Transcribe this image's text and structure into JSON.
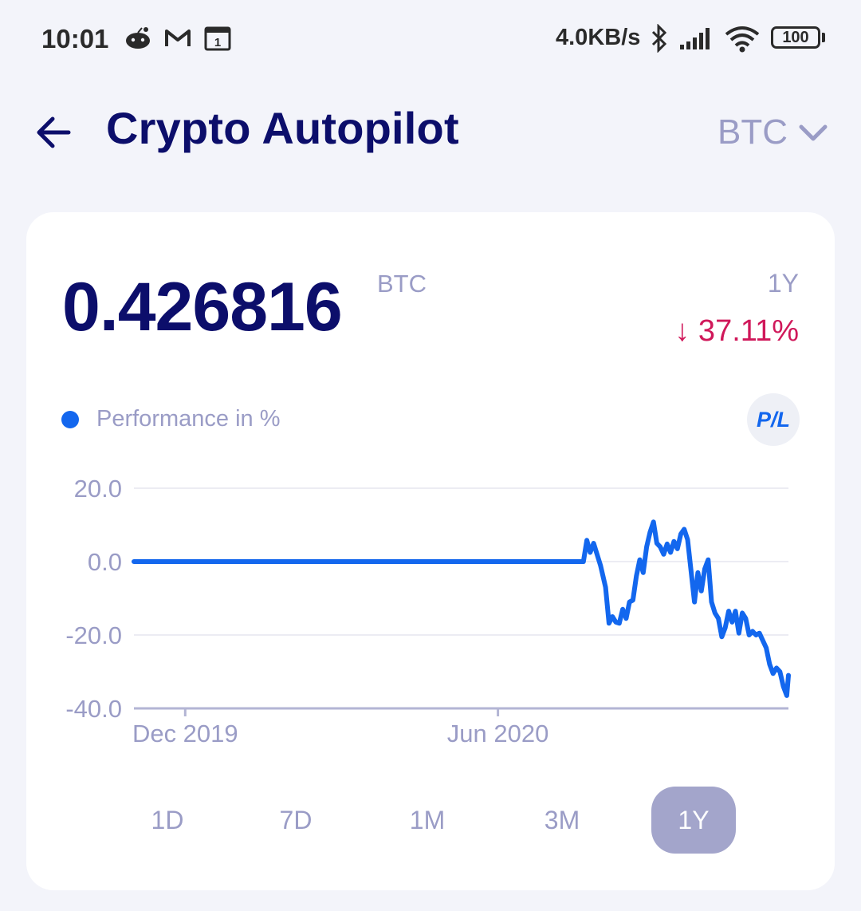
{
  "status_bar": {
    "time": "10:01",
    "net_speed": "4.0KB/s",
    "battery": "100",
    "calendar_day": "1",
    "icons": [
      "reddit-icon",
      "gmail-icon",
      "calendar-icon",
      "bluetooth-icon",
      "signal-icon",
      "wifi-icon",
      "battery-icon"
    ]
  },
  "header": {
    "title": "Crypto Autopilot",
    "currency": "BTC"
  },
  "card": {
    "balance": "0.426816",
    "balance_unit": "BTC",
    "period": "1Y",
    "change": "↓ 37.11%",
    "legend": "Performance in %",
    "pl_button": "P/L"
  },
  "colors": {
    "title": "#0c0e6b",
    "muted": "#9a9cc6",
    "line": "#1367ee",
    "negative": "#d0185a",
    "active_tab": "#a3a5cb"
  },
  "chart_data": {
    "type": "line",
    "ylabel": "",
    "xlabel": "",
    "ylim": [
      -40,
      20
    ],
    "y_ticks": [
      "20.0",
      "0.0",
      "-20.0",
      "-40.0"
    ],
    "x_ticks": [
      {
        "label": "Dec 2019",
        "date": "2019-12-01"
      },
      {
        "label": "Jun 2020",
        "date": "2020-06-01"
      }
    ],
    "grid": true,
    "series": [
      {
        "points": [
          [
            "2019-11-01",
            0
          ],
          [
            "2020-03-01",
            0
          ],
          [
            "2020-07-21",
            0
          ],
          [
            "2020-07-23",
            5.8
          ],
          [
            "2020-07-25",
            2.5
          ],
          [
            "2020-07-27",
            5.0
          ],
          [
            "2020-07-31",
            -1.0
          ],
          [
            "2020-08-03",
            -7.0
          ],
          [
            "2020-08-05",
            -16.8
          ],
          [
            "2020-08-07",
            -15.0
          ],
          [
            "2020-08-09",
            -16.5
          ],
          [
            "2020-08-11",
            -16.8
          ],
          [
            "2020-08-13",
            -13.0
          ],
          [
            "2020-08-15",
            -15.5
          ],
          [
            "2020-08-17",
            -11.0
          ],
          [
            "2020-08-19",
            -10.5
          ],
          [
            "2020-08-21",
            -4.0
          ],
          [
            "2020-08-23",
            0.5
          ],
          [
            "2020-08-25",
            -3.0
          ],
          [
            "2020-08-27",
            4.0
          ],
          [
            "2020-08-29",
            8.0
          ],
          [
            "2020-08-31",
            10.8
          ],
          [
            "2020-09-02",
            5.0
          ],
          [
            "2020-09-04",
            4.0
          ],
          [
            "2020-09-06",
            2.0
          ],
          [
            "2020-09-08",
            4.8
          ],
          [
            "2020-09-10",
            2.5
          ],
          [
            "2020-09-12",
            5.5
          ],
          [
            "2020-09-14",
            3.5
          ],
          [
            "2020-09-16",
            7.5
          ],
          [
            "2020-09-18",
            8.8
          ],
          [
            "2020-09-20",
            6.0
          ],
          [
            "2020-09-22",
            -2.5
          ],
          [
            "2020-09-24",
            -11.0
          ],
          [
            "2020-09-26",
            -3.0
          ],
          [
            "2020-09-28",
            -8.0
          ],
          [
            "2020-09-30",
            -2.0
          ],
          [
            "2020-10-02",
            0.5
          ],
          [
            "2020-10-04",
            -11.0
          ],
          [
            "2020-10-06",
            -14.0
          ],
          [
            "2020-10-08",
            -15.5
          ],
          [
            "2020-10-10",
            -20.5
          ],
          [
            "2020-10-12",
            -18.0
          ],
          [
            "2020-10-14",
            -13.5
          ],
          [
            "2020-10-16",
            -16.5
          ],
          [
            "2020-10-18",
            -13.5
          ],
          [
            "2020-10-20",
            -19.5
          ],
          [
            "2020-10-22",
            -14.0
          ],
          [
            "2020-10-24",
            -15.5
          ],
          [
            "2020-10-26",
            -20.0
          ],
          [
            "2020-10-28",
            -19.0
          ],
          [
            "2020-10-30",
            -20.0
          ],
          [
            "2020-11-01",
            -19.5
          ],
          [
            "2020-11-03",
            -21.5
          ],
          [
            "2020-11-05",
            -23.5
          ],
          [
            "2020-11-07",
            -28.0
          ],
          [
            "2020-11-09",
            -30.5
          ],
          [
            "2020-11-11",
            -29.0
          ],
          [
            "2020-11-13",
            -30.0
          ],
          [
            "2020-11-15",
            -34.0
          ],
          [
            "2020-11-17",
            -36.5
          ],
          [
            "2020-11-18",
            -31.0
          ]
        ]
      }
    ],
    "x_domain": [
      "2019-11-01",
      "2020-11-18"
    ]
  },
  "range_tabs": [
    {
      "label": "1D",
      "active": false
    },
    {
      "label": "7D",
      "active": false
    },
    {
      "label": "1M",
      "active": false
    },
    {
      "label": "3M",
      "active": false
    },
    {
      "label": "1Y",
      "active": true
    }
  ]
}
